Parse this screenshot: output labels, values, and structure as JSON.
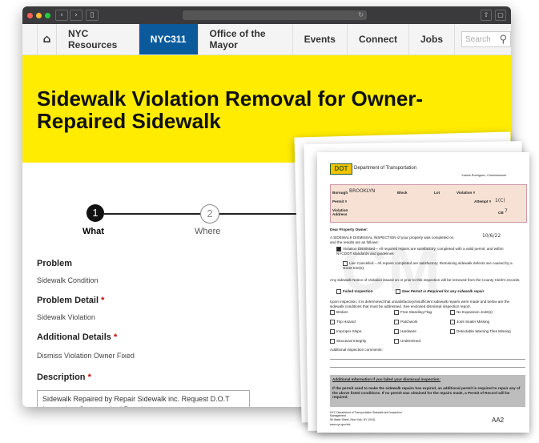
{
  "nav": {
    "items": [
      "NYC Resources",
      "NYC311",
      "Office of the Mayor",
      "Events",
      "Connect",
      "Jobs"
    ],
    "active": "NYC311",
    "search_placeholder": "Search"
  },
  "banner": {
    "title": "Sidewalk Violation Removal for Owner-Repaired Sidewalk"
  },
  "steps": [
    {
      "number": "1",
      "label": "What"
    },
    {
      "number": "2",
      "label": "Where"
    }
  ],
  "form": {
    "problem_label": "Problem",
    "problem_value": "Sidewalk Condition",
    "problem_detail_label": "Problem Detail",
    "problem_detail_value": "Sidewalk Violation",
    "additional_details_label": "Additional Details",
    "additional_details_value": "Dismiss Violation Owner Fixed",
    "description_label": "Description",
    "description_value": "Sidewalk Repaired by Repair Sidewalk inc. Request D.O.T Inspection. See attached Permits",
    "required_mark": "*"
  },
  "document": {
    "agency": "Department of Transportation",
    "commissioner": "Ydanis Rodriguez, Commissioner",
    "logo": "DOT",
    "borough_label": "Borough",
    "borough_value": "BROOKLYN",
    "block_label": "Block",
    "lot_label": "Lot",
    "violation_label": "Violation #",
    "permit_label": "Permit #",
    "attempt_label": "Attempt #",
    "attempt_value": "1(C)",
    "violation_address_label": "Violation Address",
    "cb_label": "CB",
    "cb_value": "7",
    "dear": "Dear Property Owner:",
    "intro": "A SIDEWALK DISMISSAL INSPECTION of your property was completed on",
    "date_value": "10/6/22",
    "intro2": "and the results are as follows:",
    "dismissed": "Violation Dismissed – All required repairs are satisfactory, completed with a valid permit, and within NYCDOT standards and guidelines",
    "lien": "Lien Cancelled – All repairs completed are satisfactory. Remaining sidewalk defects are caused by a street tree(s).",
    "any_notice": "Any sidewalk Notice of Violation issued on or prior to this inspection will be removed from the County Clerk's records.",
    "failed": "Failed Inspection",
    "new_permit": "New Permit is Required for any sidewalk repair",
    "upon": "Upon inspection, it is determined that unsatisfactory/insufficient sidewalk repairs were made and below are the sidewalk conditions that must be addressed. See enclosed dismissal inspection report.",
    "conditions": [
      "Broken",
      "Free Standing Flag",
      "No Expansion Joint(s)",
      "Trip Hazard",
      "Patchwork",
      "Joint Sealer Missing",
      "Improper Slope",
      "Hardware",
      "Detectable Warning Tiles Missing",
      "Structural Integrity",
      "Undermined"
    ],
    "comments_label": "Additional inspection comments:",
    "failed_info_title": "Additional Information if you failed your dismissal inspection:",
    "failed_info_text": "If the permit used to make the sidewalk repairs has expired, an additional permit is required to repair any of the above listed conditions. If no permit was obtained for the repairs made, a Permit of Record will be required.",
    "footer_org": "NYC Department of Transportation Sidewalk and Inspection Management",
    "footer_addr": "55 Water Street, New York, NY 10041",
    "footer_site": "www.nyc.gov/dot",
    "form_code": "AA2"
  }
}
